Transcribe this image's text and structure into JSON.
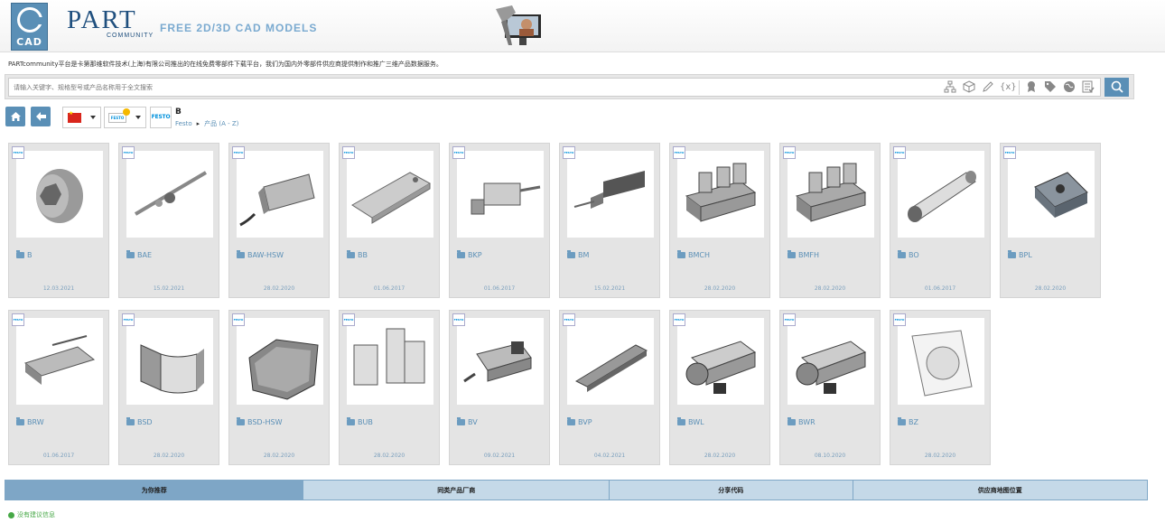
{
  "header": {
    "logo_text": "CAD",
    "brand": "PART",
    "brand_sub": "COMMUNITY",
    "tagline": "FREE 2D/3D CAD MODELS"
  },
  "intro": "PARTcommunity平台是卡第那维软件技术(上海)有限公司推出的在线免费零部件下载平台，我们为国内外零部件供应商提供制作和推广三维产品数据服务。",
  "search": {
    "placeholder": "请输入关键字、规格型号或产品名称用于全文搜索",
    "tools": [
      "hierarchy-icon",
      "cube-icon",
      "pencil-icon",
      "variables-icon",
      "award-icon",
      "tag-icon",
      "globe-icon",
      "checklist-icon"
    ]
  },
  "nav": {
    "title": "B",
    "crumb_supplier": "Festo",
    "crumb_products": "产品 (A - Z)",
    "festo_label": "FESTO"
  },
  "cards": [
    {
      "label": "B",
      "date": "12.03.2021",
      "shape": "plug"
    },
    {
      "label": "BAE",
      "date": "15.02.2021",
      "shape": "rod"
    },
    {
      "label": "BAW-HSW",
      "date": "28.02.2020",
      "shape": "block-cable"
    },
    {
      "label": "BB",
      "date": "01.06.2017",
      "shape": "plate"
    },
    {
      "label": "BKP",
      "date": "01.06.2017",
      "shape": "clamp"
    },
    {
      "label": "BM",
      "date": "15.02.2021",
      "shape": "bm"
    },
    {
      "label": "BMCH",
      "date": "28.02.2020",
      "shape": "manifold"
    },
    {
      "label": "BMFH",
      "date": "28.02.2020",
      "shape": "manifold"
    },
    {
      "label": "BO",
      "date": "01.06.2017",
      "shape": "cylinder"
    },
    {
      "label": "BPL",
      "date": "28.02.2020",
      "shape": "square-plate"
    },
    {
      "label": "BRW",
      "date": "01.06.2017",
      "shape": "grate"
    },
    {
      "label": "BSD",
      "date": "28.02.2020",
      "shape": "bracket"
    },
    {
      "label": "BSD-HSW",
      "date": "28.02.2020",
      "shape": "shield"
    },
    {
      "label": "BUB",
      "date": "28.02.2020",
      "shape": "posts"
    },
    {
      "label": "BV",
      "date": "09.02.2021",
      "shape": "valve"
    },
    {
      "label": "BVP",
      "date": "04.02.2021",
      "shape": "bar"
    },
    {
      "label": "BWL",
      "date": "28.02.2020",
      "shape": "slide"
    },
    {
      "label": "BWR",
      "date": "08.10.2020",
      "shape": "slide"
    },
    {
      "label": "BZ",
      "date": "28.02.2020",
      "shape": "sheet"
    }
  ],
  "tabs": [
    {
      "label": "为你推荐",
      "active": true
    },
    {
      "label": "同类产品厂商",
      "active": false
    },
    {
      "label": "分享代码",
      "active": false
    },
    {
      "label": "供应商地图位置",
      "active": false
    }
  ],
  "no_suggestion": "没有建议信息",
  "colors": {
    "accent": "#5a8fb6",
    "card_bg": "#e4e4e4",
    "tab_bg": "#c5d9e8",
    "tab_active": "#7ea6c6"
  }
}
